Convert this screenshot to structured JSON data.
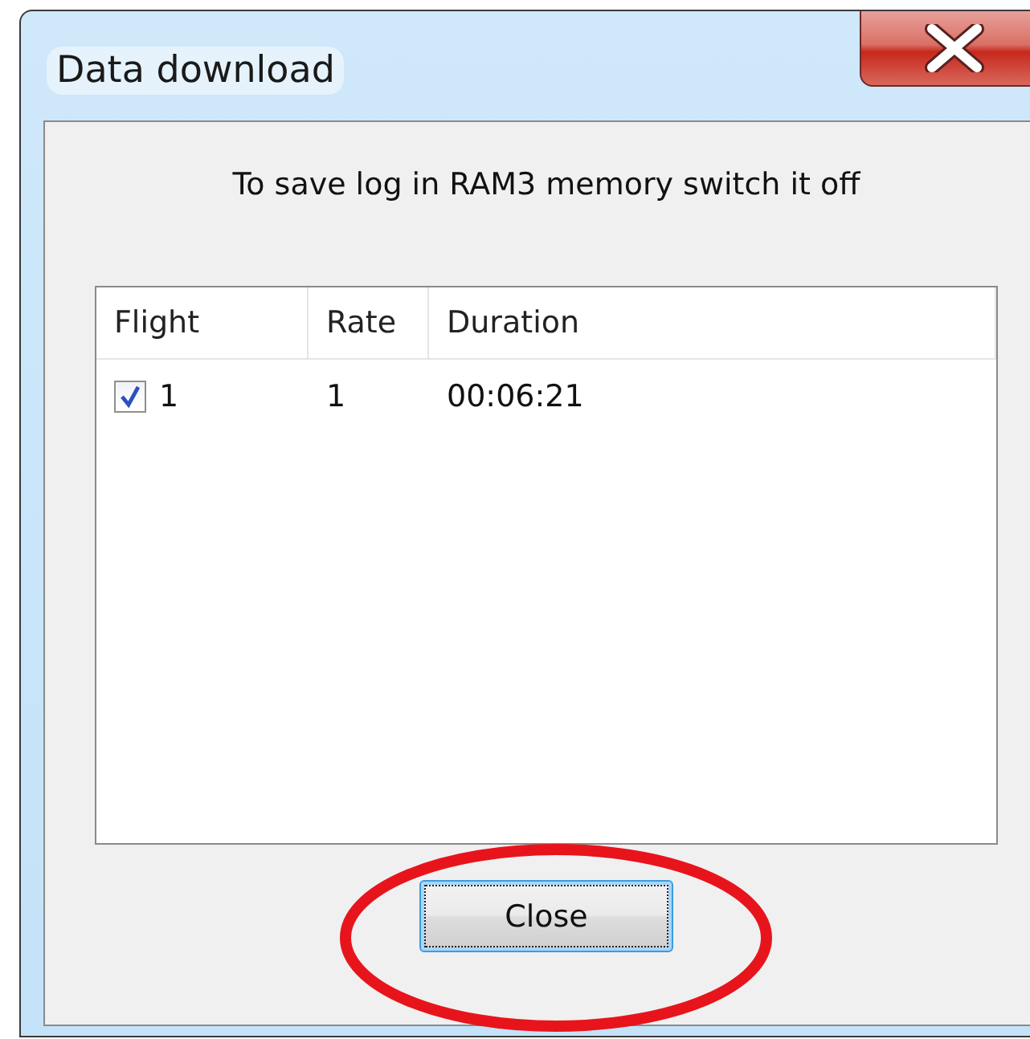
{
  "window": {
    "title": "Data download"
  },
  "message": "To save log in RAM3 memory switch it off",
  "table": {
    "columns": [
      "Flight",
      "Rate",
      "Duration"
    ],
    "rows": [
      {
        "checked": true,
        "cells": [
          "1",
          "1",
          "00:06:21"
        ]
      }
    ]
  },
  "buttons": [
    {
      "label": "Close",
      "focused": true
    }
  ]
}
